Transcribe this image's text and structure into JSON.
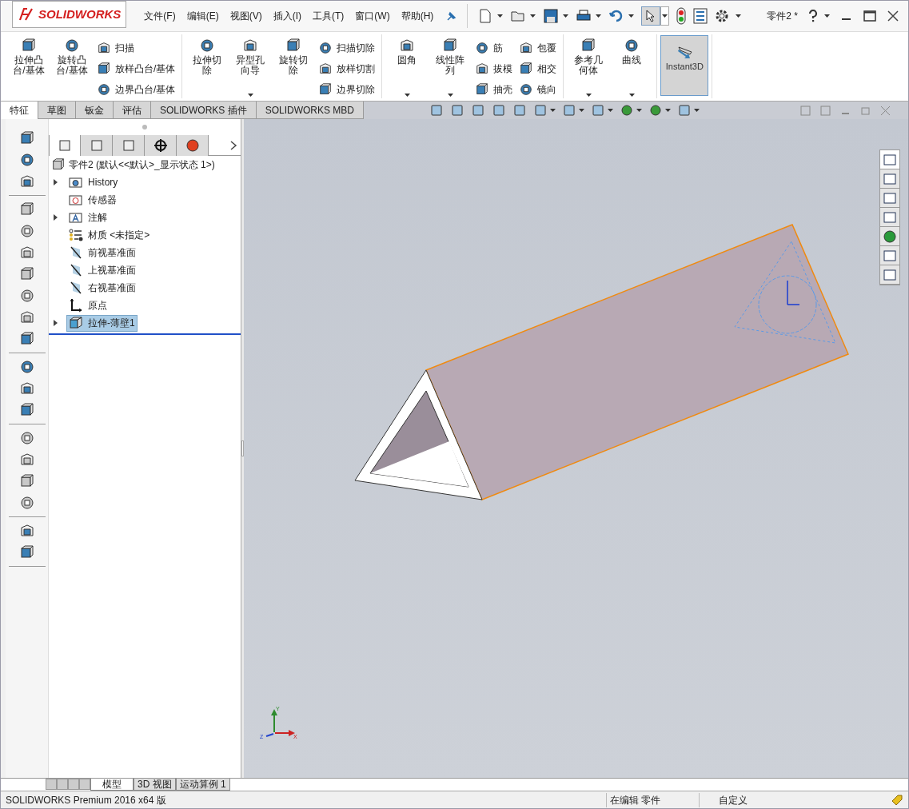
{
  "app": {
    "logo": "SOLIDWORKS",
    "document_title": "零件2 *"
  },
  "menu": [
    "文件(F)",
    "编辑(E)",
    "视图(V)",
    "插入(I)",
    "工具(T)",
    "窗口(W)",
    "帮助(H)"
  ],
  "ribbon": {
    "groups": [
      {
        "columns": [
          {
            "kind": "large",
            "label": "拉伸凸台/基体",
            "dropdown": false
          },
          {
            "kind": "large",
            "label": "旋转凸台/基体",
            "dropdown": false
          },
          {
            "kind": "stack",
            "items": [
              "扫描",
              "放样凸台/基体",
              "边界凸台/基体"
            ]
          }
        ]
      },
      {
        "columns": [
          {
            "kind": "large",
            "label": "拉伸切除",
            "dropdown": false
          },
          {
            "kind": "large",
            "label": "异型孔向导",
            "dropdown": true
          },
          {
            "kind": "large",
            "label": "旋转切除",
            "dropdown": false
          },
          {
            "kind": "stack",
            "items": [
              "扫描切除",
              "放样切割",
              "边界切除"
            ]
          }
        ]
      },
      {
        "columns": [
          {
            "kind": "large",
            "label": "圆角",
            "dropdown": true
          },
          {
            "kind": "large",
            "label": "线性阵列",
            "dropdown": true
          },
          {
            "kind": "stack",
            "items": [
              "筋",
              "拔模",
              "抽壳"
            ]
          },
          {
            "kind": "stack",
            "items": [
              "包覆",
              "相交",
              "镜向"
            ]
          }
        ]
      },
      {
        "columns": [
          {
            "kind": "large",
            "label": "参考几何体",
            "dropdown": true
          },
          {
            "kind": "large",
            "label": "曲线",
            "dropdown": true
          }
        ]
      },
      {
        "columns": [
          {
            "kind": "toggle",
            "label": "Instant3D",
            "on": true
          }
        ]
      }
    ]
  },
  "tabs": [
    {
      "label": "特征",
      "selected": true
    },
    {
      "label": "草图",
      "selected": false
    },
    {
      "label": "钣金",
      "selected": false
    },
    {
      "label": "评估",
      "selected": false
    },
    {
      "label": "SOLIDWORKS 插件",
      "selected": false
    },
    {
      "label": "SOLIDWORKS MBD",
      "selected": false
    }
  ],
  "manager_tabs": [
    {
      "selected": true
    },
    {
      "selected": false
    },
    {
      "selected": false
    },
    {
      "selected": false
    },
    {
      "selected": false
    }
  ],
  "tree": {
    "root": "零件2  (默认<<默认>_显示状态 1>)",
    "items": [
      {
        "label": "History",
        "expandable": true,
        "selected": false
      },
      {
        "label": "传感器",
        "expandable": false,
        "selected": false
      },
      {
        "label": "注解",
        "expandable": true,
        "selected": false
      },
      {
        "label": "材质 <未指定>",
        "expandable": false,
        "selected": false
      },
      {
        "label": "前视基准面",
        "expandable": false,
        "selected": false
      },
      {
        "label": "上视基准面",
        "expandable": false,
        "selected": false
      },
      {
        "label": "右视基准面",
        "expandable": false,
        "selected": false
      },
      {
        "label": "原点",
        "expandable": false,
        "selected": false
      },
      {
        "label": "拉伸-薄壁1",
        "expandable": true,
        "selected": true
      }
    ]
  },
  "triad": {
    "y": "Y",
    "x": "X",
    "z": "Z"
  },
  "model_tabs": [
    {
      "label": "模型",
      "selected": true
    },
    {
      "label": "3D 视图",
      "selected": false
    },
    {
      "label": "运动算例 1",
      "selected": false
    }
  ],
  "status_bar": {
    "product": "SOLIDWORKS Premium 2016 x64 版",
    "mode": "在编辑 零件",
    "units": "自定义"
  }
}
